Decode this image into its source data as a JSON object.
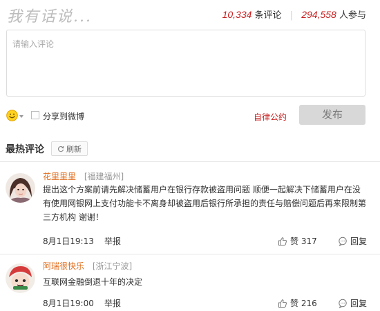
{
  "header": {
    "title": "我有话说...",
    "comment_count": "10,334",
    "comment_unit": "条评论",
    "participant_count": "294,558",
    "participant_unit": "人参与"
  },
  "comment_input": {
    "placeholder": "请输入评论"
  },
  "toolbar": {
    "emoji_icon": "smiley-face-icon",
    "share_label": "分享到微博",
    "rules_link": "自律公约",
    "submit_label": "发布"
  },
  "hot": {
    "title": "最热评论",
    "refresh_label": "刷新"
  },
  "comments": [
    {
      "user": "花里里里",
      "location": "[福建福州]",
      "text": "提出这个方案前请先解决储蓄用户在银行存款被盗用问题 顺便一起解决下储蓄用户在没有使用网银网上支付功能卡不离身却被盗用后银行所承担的责任与赔偿问题后再来限制第三方机构 谢谢！",
      "time": "8月1日19:13",
      "report": "举报",
      "likes": "赞 317",
      "reply": "回复"
    },
    {
      "user": "阿瑞很快乐",
      "location": "[浙江宁波]",
      "text": "互联网金融倒退十年的决定",
      "time": "8月1日19:00",
      "report": "举报",
      "likes": "赞 216",
      "reply": "回复"
    }
  ],
  "colors": {
    "accent_red": "#c81d1d",
    "username_orange": "#e06c1a",
    "muted_gray": "#999999",
    "button_gray": "#d8d8d8"
  }
}
